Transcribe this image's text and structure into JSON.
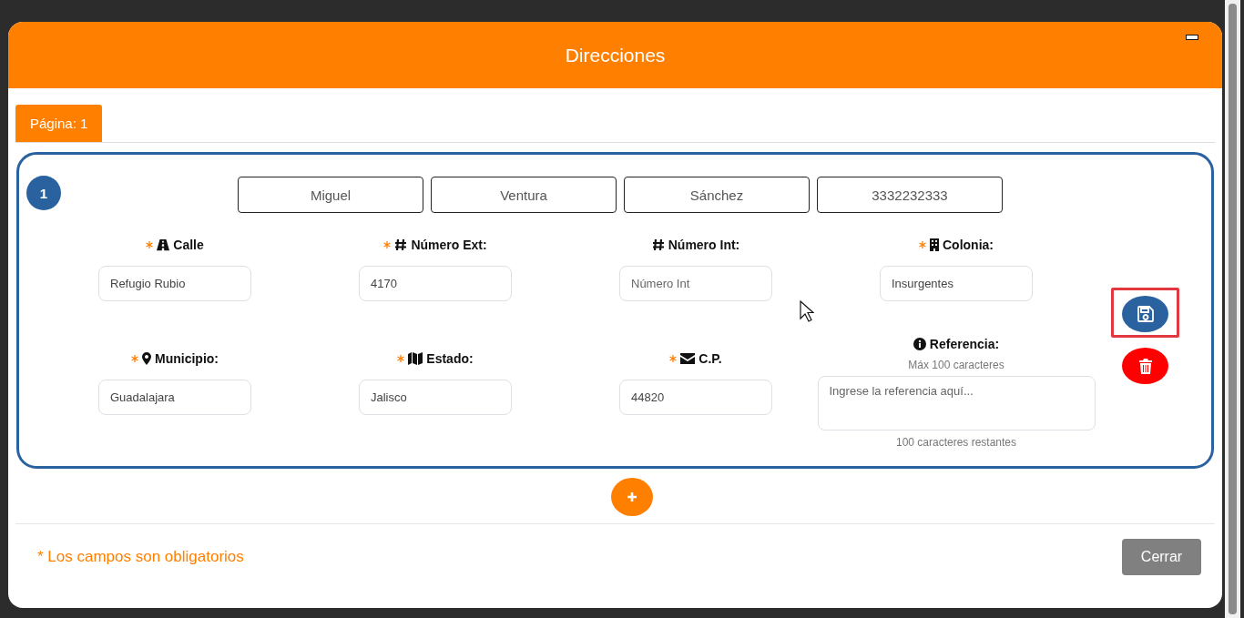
{
  "modal": {
    "title": "Direcciones"
  },
  "tabs": [
    {
      "label": "Página: 1",
      "selected": true
    }
  ],
  "address_card": {
    "number": "1",
    "contact": [
      "Miguel",
      "Ventura",
      "Sánchez",
      "3332232333"
    ],
    "rows": [
      [
        {
          "kind": "text",
          "label": "Calle",
          "required": true,
          "value": "Refugio Rubio"
        },
        {
          "kind": "text",
          "label": "Número Ext:",
          "required": true,
          "value": "4170"
        },
        {
          "kind": "text",
          "label": "Número Int:",
          "required": false,
          "placeholder": "Número Int"
        },
        {
          "kind": "text",
          "label": "Colonia:",
          "required": true,
          "value": "Insurgentes"
        }
      ],
      [
        {
          "kind": "text",
          "label": "Municipio:",
          "required": true,
          "value": "Guadalajara"
        },
        {
          "kind": "text",
          "label": "Estado:",
          "required": true,
          "value": "Jalisco"
        },
        {
          "kind": "text",
          "label": "C.P.",
          "required": true,
          "value": "44820"
        },
        {
          "kind": "textarea",
          "label": "Referencia:",
          "required": false,
          "hint": "Máx 100 caracteres",
          "placeholder": "Ingrese la referencia aquí...",
          "counter": "100 caracteres restantes"
        }
      ]
    ],
    "actions": [
      {
        "kind": "save",
        "highlighted": true
      },
      {
        "kind": "delete",
        "highlighted": false
      }
    ]
  },
  "footer": {
    "note": "* Los campos son obligatorios",
    "close_button": "Cerrar"
  }
}
